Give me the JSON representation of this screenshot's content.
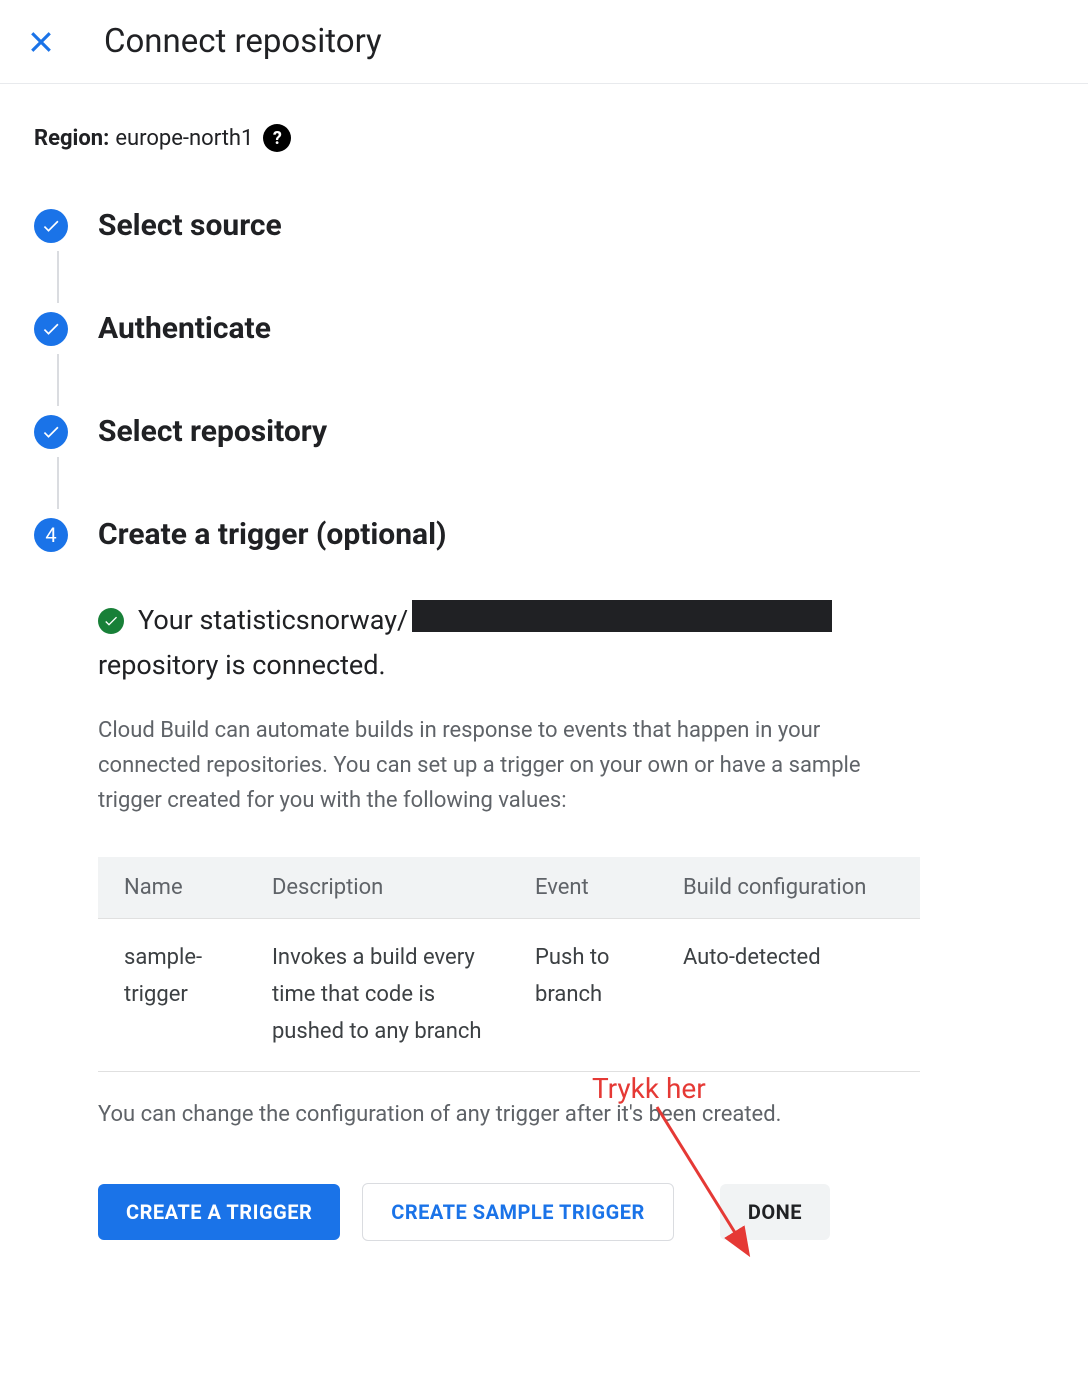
{
  "header": {
    "title": "Connect repository"
  },
  "region": {
    "label": "Region:",
    "value": "europe-north1"
  },
  "steps": [
    {
      "title": "Select source",
      "completed": true
    },
    {
      "title": "Authenticate",
      "completed": true
    },
    {
      "title": "Select repository",
      "completed": true
    },
    {
      "title": "Create a trigger (optional)",
      "completed": false,
      "number": "4"
    }
  ],
  "status": {
    "prefix": "Your statisticsnorway/",
    "suffix": "repository is connected."
  },
  "description": "Cloud Build can automate builds in response to events that happen in your connected repositories. You can set up a trigger on your own or have a sample trigger created for you with the following values:",
  "table": {
    "headers": {
      "name": "Name",
      "description": "Description",
      "event": "Event",
      "build": "Build configuration"
    },
    "row": {
      "name": "sample-trigger",
      "description": "Invokes a build every time that code is pushed to any branch",
      "event": "Push to branch",
      "build": "Auto-detected"
    }
  },
  "annotation": "Trykk her",
  "footer_note": "You can change the configuration of any trigger after it's been created.",
  "buttons": {
    "create_trigger": "CREATE A TRIGGER",
    "create_sample": "CREATE SAMPLE TRIGGER",
    "done": "DONE"
  }
}
